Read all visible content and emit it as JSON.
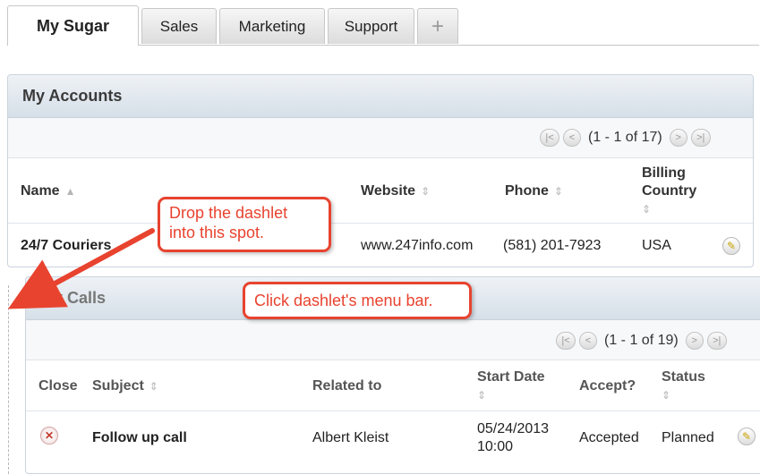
{
  "tabs": [
    {
      "label": "My Sugar"
    },
    {
      "label": "Sales"
    },
    {
      "label": "Marketing"
    },
    {
      "label": "Support"
    },
    {
      "label": "+"
    }
  ],
  "accounts": {
    "title": "My Accounts",
    "pager": "(1 - 1 of 17)",
    "columns": {
      "name": "Name",
      "website": "Website",
      "phone": "Phone",
      "billing_line1": "Billing",
      "billing_line2": "Country"
    },
    "row": {
      "name": "24/7 Couriers",
      "website": "www.247info.com",
      "phone": "(581) 201-7923",
      "country": "USA"
    }
  },
  "calls": {
    "title": "My Calls",
    "pager": "(1 - 1 of 19)",
    "columns": {
      "close": "Close",
      "subject": "Subject",
      "related": "Related to",
      "start_line1": "Start Date",
      "accept": "Accept?",
      "status": "Status"
    },
    "row": {
      "subject": "Follow up call",
      "related": "Albert Kleist",
      "date": "05/24/2013",
      "time": "10:00",
      "accept": "Accepted",
      "status": "Planned"
    }
  },
  "callouts": {
    "drop_line1": "Drop the dashlet",
    "drop_line2": "into this spot.",
    "menu": "Click dashlet's menu bar."
  },
  "icons": {
    "sort": "sort-icon",
    "edit": "pencil-icon",
    "close": "close-icon",
    "first": "first-page-icon",
    "prev": "prev-page-icon",
    "next": "next-page-icon",
    "last": "last-page-icon"
  },
  "colors": {
    "callout": "#e8432f",
    "link": "#2a5fb0",
    "header": "#d6dfe8"
  }
}
